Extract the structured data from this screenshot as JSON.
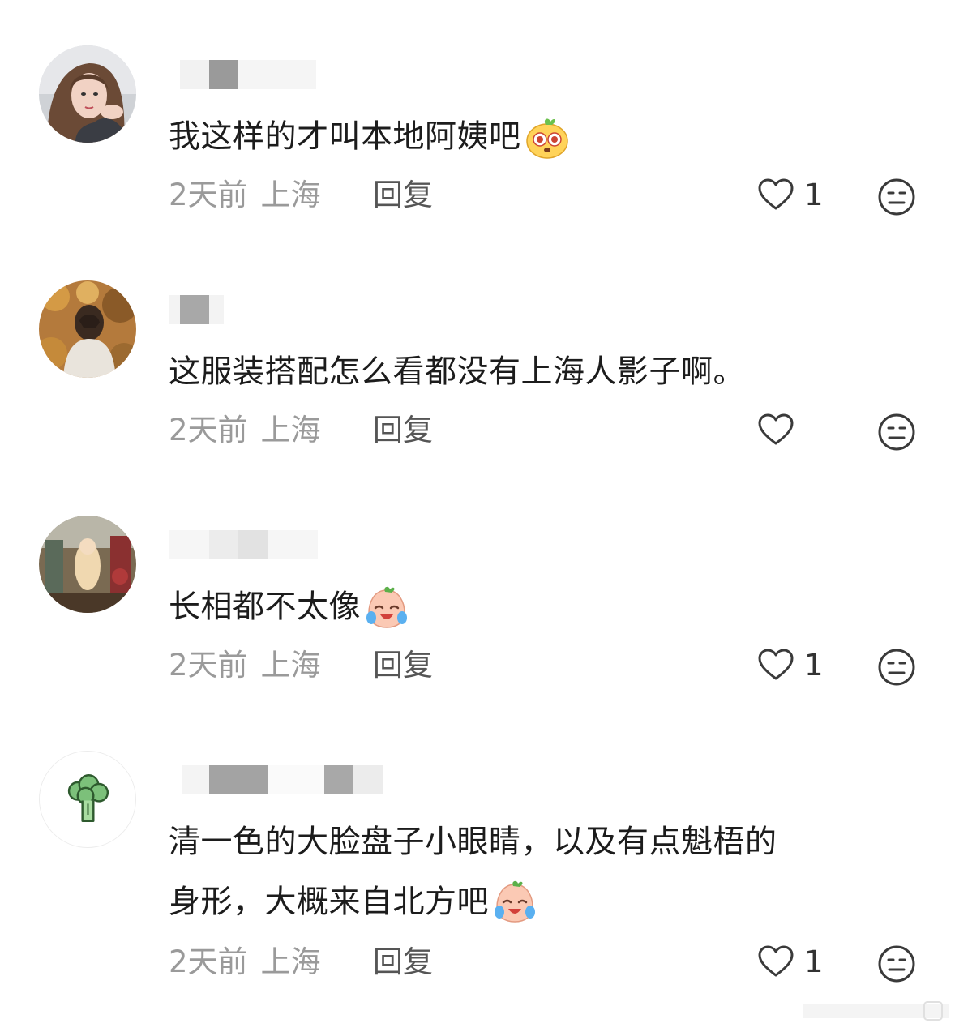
{
  "comments": [
    {
      "avatar": "woman-portrait-avatar",
      "username": "",
      "text": "我这样的才叫本地阿姨吧",
      "emoji": "jiggly-eyes-emoji",
      "time": "2天前",
      "location": "上海",
      "reply_label": "回复",
      "like_count": "1"
    },
    {
      "avatar": "autumn-leaves-portrait-avatar",
      "username": "",
      "text": "这服装搭配怎么看都没有上海人影子啊。",
      "emoji": "",
      "time": "2天前",
      "location": "上海",
      "reply_label": "回复",
      "like_count": ""
    },
    {
      "avatar": "theater-stage-avatar",
      "username": "",
      "text": "长相都不太像",
      "emoji": "laugh-cry-emoji",
      "time": "2天前",
      "location": "上海",
      "reply_label": "回复",
      "like_count": "1"
    },
    {
      "avatar": "broccoli-avatar",
      "username": "",
      "text_line1": "清一色的大脸盘子小眼睛，以及有点魁梧的",
      "text_line2": "身形，大概来自北方吧",
      "emoji": "laugh-cry-emoji",
      "time": "2天前",
      "location": "上海",
      "reply_label": "回复",
      "like_count": "1"
    }
  ],
  "colors": {
    "text": "#1c1c1c",
    "meta": "#9a9a9a",
    "reply": "#555555",
    "icon": "#3a3a3a"
  }
}
